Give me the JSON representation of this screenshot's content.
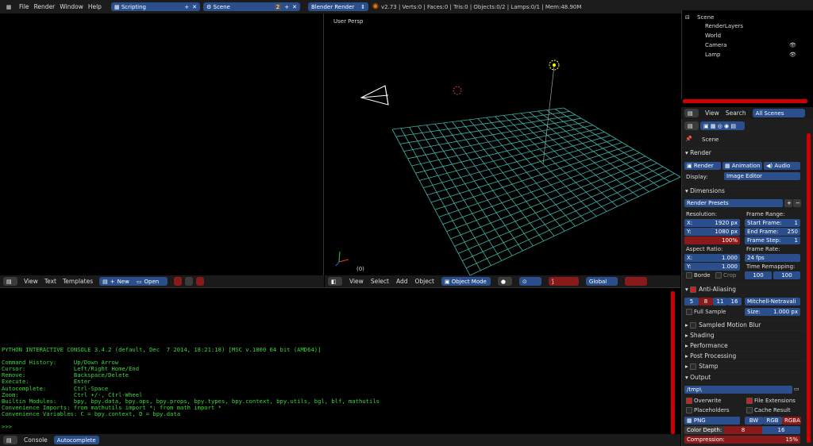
{
  "topbar": {
    "menus": [
      "File",
      "Render",
      "Window",
      "Help"
    ],
    "layout": "Scripting",
    "scene": "Scene",
    "scene_users": "2",
    "engine": "Blender Render",
    "info": "v2.73 | Verts:0 | Faces:0 | Tris:0 | Objects:0/2 | Lamps:0/1 | Mem:48.90M"
  },
  "viewport": {
    "label": "User Persp",
    "frame": "(0)",
    "menus": [
      "View",
      "Select",
      "Add",
      "Object"
    ],
    "mode": "Object Mode",
    "orientation": "Global"
  },
  "texteditor": {
    "menus": [
      "View",
      "Text",
      "Templates"
    ],
    "new_label": "New",
    "open_label": "Open"
  },
  "console": {
    "lines": [
      "PYTHON INTERACTIVE CONSOLE 3.4.2 (default, Dec  7 2014, 18:21:18) [MSC v.1800 64 bit (AMD64)]",
      "",
      "Command History:     Up/Down Arrow",
      "Cursor:              Left/Right Home/End",
      "Remove:              Backspace/Delete",
      "Execute:             Enter",
      "Autocomplete:        Ctrl-Space",
      "Zoom:                Ctrl +/-, Ctrl-Wheel",
      "Builtin Modules:     bpy, bpy.data, bpy.ops, bpy.props, bpy.types, bpy.context, bpy.utils, bgl, blf, mathutils",
      "Convenience Imports: from mathutils import *; from math import *",
      "Convenience Variables: C = bpy.context, D = bpy.data",
      "",
      ">>> "
    ],
    "footer_console": "Console",
    "footer_autocomplete": "Autocomplete"
  },
  "outliner": {
    "items": [
      {
        "label": "Scene",
        "indent": 0
      },
      {
        "label": "RenderLayers",
        "indent": 1
      },
      {
        "label": "World",
        "indent": 1
      },
      {
        "label": "Camera",
        "indent": 1
      },
      {
        "label": "Lamp",
        "indent": 1
      }
    ],
    "view_menu": "View",
    "search_menu": "Search",
    "filter": "All Scenes"
  },
  "properties": {
    "scene_path": "Scene",
    "render": {
      "title": "Render",
      "render_btn": "Render",
      "animation_btn": "Animation",
      "audio_btn": "Audio",
      "display_label": "Display:",
      "display_value": "Image Editor"
    },
    "dimensions": {
      "title": "Dimensions",
      "presets": "Render Presets",
      "resolution_label": "Resolution:",
      "res_x_label": "X:",
      "res_x": "1920 px",
      "res_y_label": "Y:",
      "res_y": "1080 px",
      "res_pct": "100%",
      "frame_range_label": "Frame Range:",
      "start_label": "Start Frame:",
      "start": "1",
      "end_label": "End Frame:",
      "end": "250",
      "step_label": "Frame Step:",
      "step": "1",
      "aspect_label": "Aspect Ratio:",
      "asp_x_label": "X:",
      "asp_x": "1.000",
      "asp_y_label": "Y:",
      "asp_y": "1.000",
      "frame_rate_label": "Frame Rate:",
      "fps": "24 fps",
      "time_remap_label": "Time Remapping:",
      "remap_old": "100",
      "remap_new": "100",
      "border_label": "Borde",
      "crop_label": "Crop"
    },
    "antialiasing": {
      "title": "Anti-Aliasing",
      "samples": [
        "5",
        "8",
        "11",
        "16"
      ],
      "filter": "Mitchell-Netravali",
      "full_sample": "Full Sample",
      "size_label": "Size:",
      "size": "1.000 px"
    },
    "collapsed": [
      "Sampled Motion Blur",
      "Shading",
      "Performance",
      "Post Processing",
      "Stamp"
    ],
    "output": {
      "title": "Output",
      "path": "/tmp\\",
      "overwrite": "Overwrite",
      "file_ext": "File Extensions",
      "placeholders": "Placeholders",
      "cache_result": "Cache Result",
      "format": "PNG",
      "bw": "BW",
      "rgb": "RGB",
      "rgba": "RGBA",
      "color_depth_label": "Color Depth:",
      "depth_8": "8",
      "depth_16": "16",
      "compression_label": "Compression:",
      "compression": "15%"
    }
  },
  "colors": {
    "accent": "#2b4f8c",
    "active": "#8a1a1a",
    "grid": "#3fb3a8",
    "console": "#3ad63a"
  }
}
